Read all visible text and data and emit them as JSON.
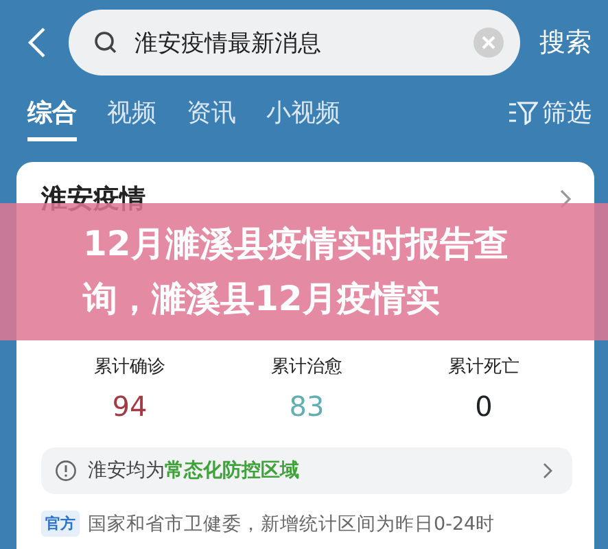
{
  "search": {
    "value": "淮安疫情最新消息",
    "button": "搜索"
  },
  "tabs": [
    {
      "label": "综合",
      "selected": true
    },
    {
      "label": "视频",
      "selected": false
    },
    {
      "label": "资讯",
      "selected": false
    },
    {
      "label": "小视频",
      "selected": false
    }
  ],
  "filter": "筛选",
  "card": {
    "title": "淮安疫情",
    "stats": [
      {
        "label": "累计确诊",
        "value": "94",
        "color": "#a33a44"
      },
      {
        "label": "累计治愈",
        "value": "83",
        "color": "#62aeb0"
      },
      {
        "label": "累计死亡",
        "value": "0",
        "color": "#1f2326"
      }
    ],
    "notice": "淮安均为**常态化防控区域**",
    "source_badge": "官方",
    "source": "国家和省市卫健委，新增统计区间为昨日0-24时"
  },
  "banner": {
    "text": "12月濉溪县疫情实时报告查询，濉溪县12月疫情实"
  }
}
